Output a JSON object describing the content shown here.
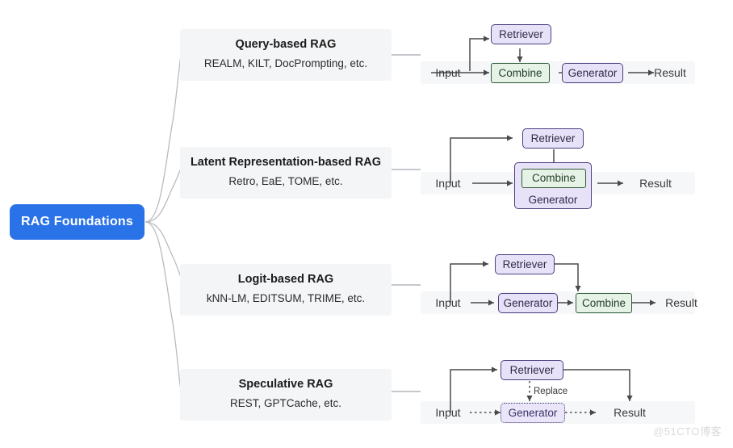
{
  "root": {
    "label": "RAG Foundations",
    "color": "#2a72e8"
  },
  "palette": {
    "retriever_fill": "#e7e2f7",
    "retriever_border": "#4b3f82",
    "combine_fill": "#e6f2e6",
    "combine_border": "#2f5d38",
    "card_bg": "#f4f5f7",
    "connector": "#b9bbbf"
  },
  "branches": [
    {
      "title": "Query-based RAG",
      "examples": "REALM, KILT, DocPrompting, etc.",
      "flow": {
        "input": "Input",
        "result": "Result",
        "retriever": "Retriever",
        "combine": "Combine",
        "generator": "Generator"
      }
    },
    {
      "title": "Latent Representation-based RAG",
      "examples": "Retro, EaE, TOME, etc.",
      "flow": {
        "input": "Input",
        "result": "Result",
        "retriever": "Retriever",
        "combine": "Combine",
        "generator": "Generator"
      }
    },
    {
      "title": "Logit-based RAG",
      "examples": "kNN-LM, EDITSUM, TRIME, etc.",
      "flow": {
        "input": "Input",
        "result": "Result",
        "retriever": "Retriever",
        "combine": "Combine",
        "generator": "Generator"
      }
    },
    {
      "title": "Speculative RAG",
      "examples": "REST, GPTCache, etc.",
      "flow": {
        "input": "Input",
        "result": "Result",
        "retriever": "Retriever",
        "generator": "Generator",
        "replace": "Replace"
      }
    }
  ],
  "watermark": "@51CTO博客"
}
